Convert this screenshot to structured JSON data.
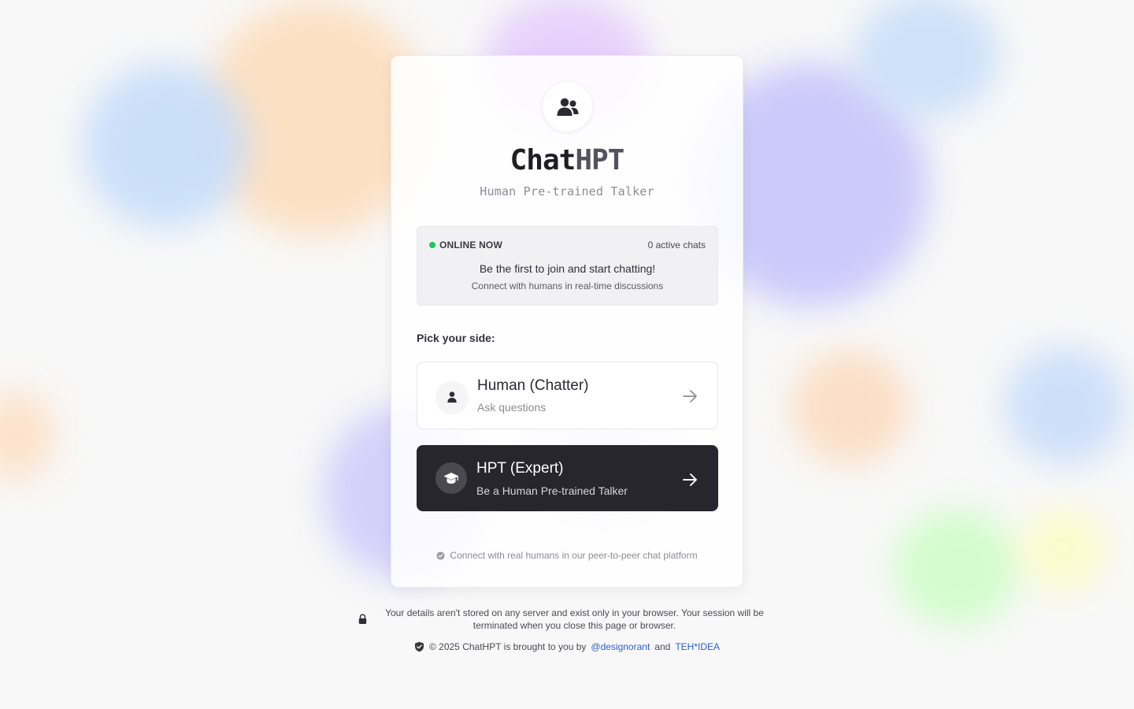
{
  "app": {
    "title_main": "Chat",
    "title_accent": "HPT",
    "subtitle": "Human Pre-trained Talker"
  },
  "status": {
    "online_label": "ONLINE NOW",
    "active_chats": "0 active chats",
    "headline": "Be the first to join and start chatting!",
    "subline": "Connect with humans in real-time discussions",
    "online_color": "#22c55e"
  },
  "pick_label": "Pick your side:",
  "options": [
    {
      "title": "Human (Chatter)",
      "description": "Ask questions",
      "icon": "user-icon"
    },
    {
      "title": "HPT (Expert)",
      "description": "Be a Human Pre-trained Talker",
      "icon": "graduation-cap-icon"
    }
  ],
  "card_footer": "Connect with real humans in our peer-to-peer chat platform",
  "privacy": "Your details aren't stored on any server and exist only in your browser. Your session will be terminated when you close this page or browser.",
  "copyright": {
    "prefix": "© 2025 ChatHPT is brought to you by",
    "link1": "@designorant",
    "joiner": "and",
    "link2": "TEH*IDEA"
  },
  "colors": {
    "accent_dark": "#27262c",
    "link": "#2d5fd0",
    "background": "#f8f8f8"
  }
}
